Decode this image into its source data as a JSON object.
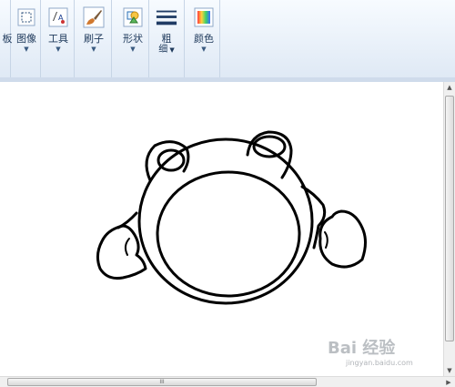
{
  "ribbon": {
    "clipboard_partial": "板",
    "image_label": "图像",
    "tools_label": "工具",
    "brush_label": "刷子",
    "shapes_label": "形状",
    "size_label_line1": "粗",
    "size_label_line2": "细",
    "colors_label": "颜色"
  },
  "scrollbar": {
    "h_thumb_grip": "III"
  },
  "watermark": {
    "brand": "Bai 经验",
    "url": "jingyan.baidu.com"
  }
}
